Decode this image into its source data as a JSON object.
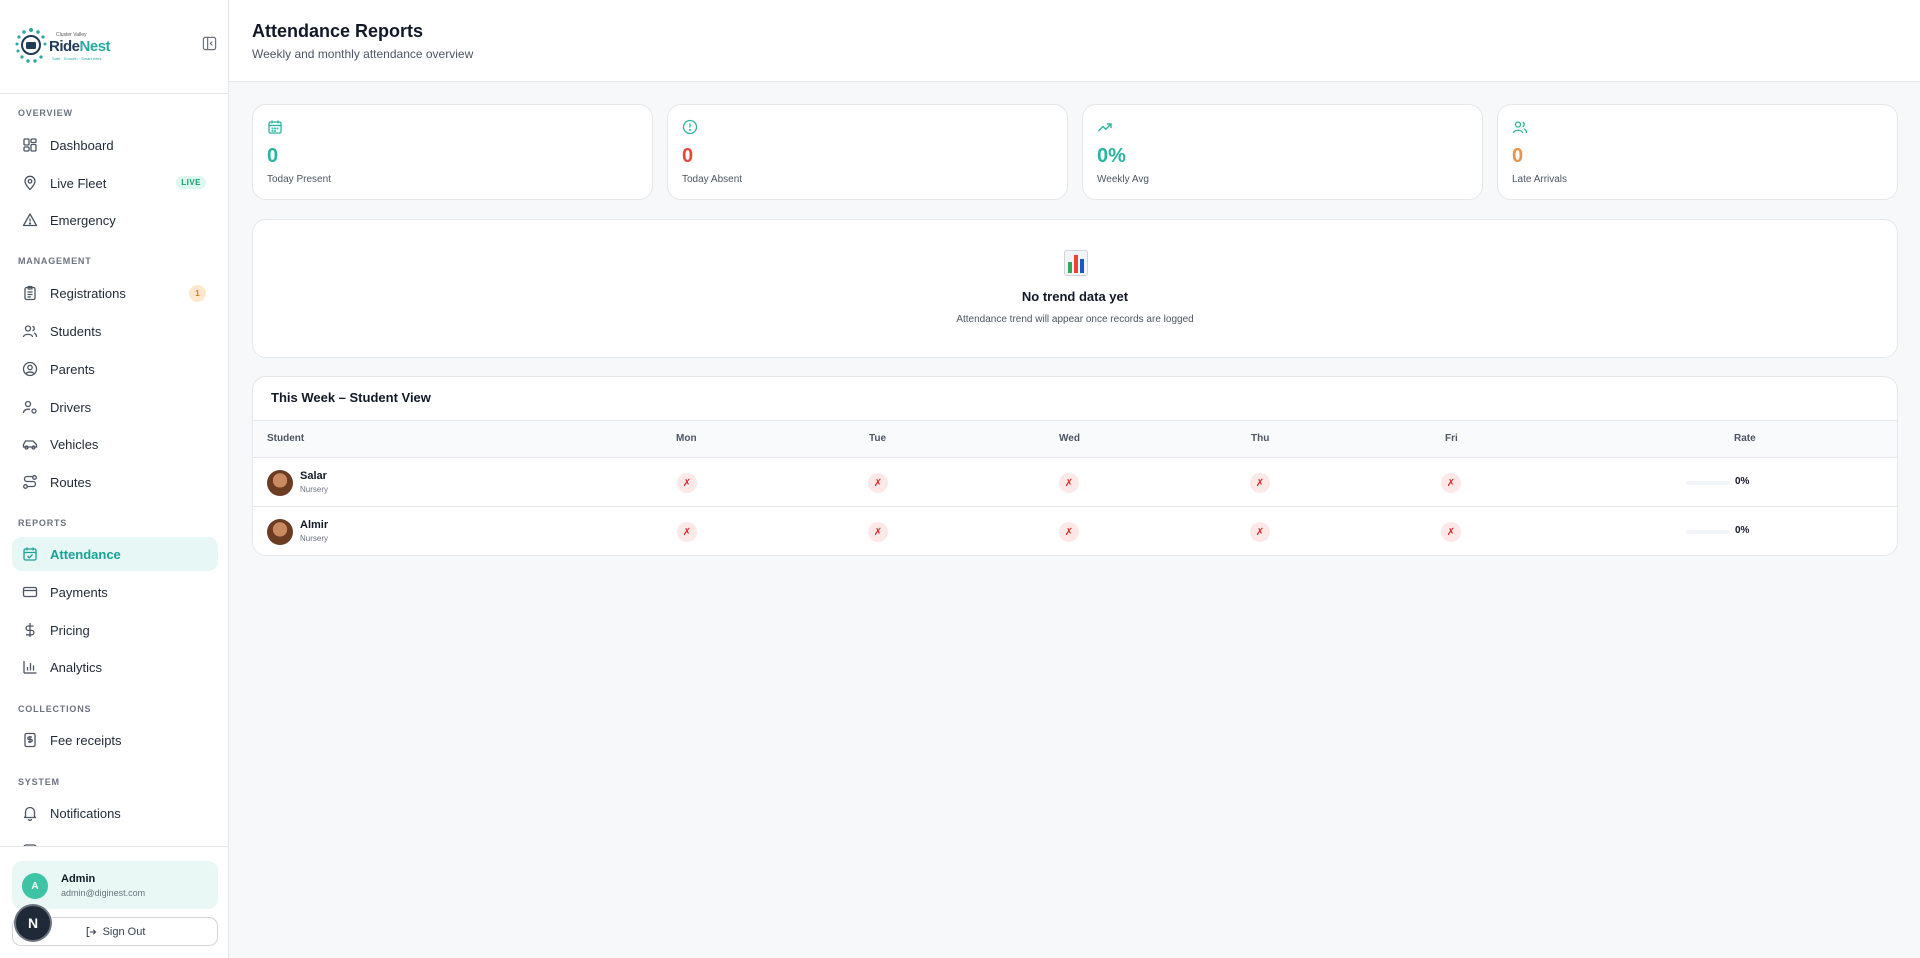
{
  "brand": {
    "line1": "Cluster Valley",
    "name_part1": "Ride",
    "name_part2": "Nest",
    "tagline": "Safe · Smooth · Smart rides"
  },
  "sidebar": {
    "sections": {
      "overview": "OVERVIEW",
      "management": "MANAGEMENT",
      "reports": "REPORTS",
      "collections": "COLLECTIONS",
      "system": "SYSTEM"
    },
    "items": {
      "dashboard": "Dashboard",
      "live_fleet": "Live Fleet",
      "live_badge": "LIVE",
      "emergency": "Emergency",
      "registrations": "Registrations",
      "registrations_count": "1",
      "students": "Students",
      "parents": "Parents",
      "drivers": "Drivers",
      "vehicles": "Vehicles",
      "routes": "Routes",
      "attendance": "Attendance",
      "payments": "Payments",
      "pricing": "Pricing",
      "analytics": "Analytics",
      "fee_receipts": "Fee receipts",
      "notifications": "Notifications"
    },
    "user": {
      "initial": "A",
      "name": "Admin",
      "email": "admin@diginest.com"
    },
    "sign_out": "Sign Out",
    "dev_badge": "N"
  },
  "header": {
    "title": "Attendance Reports",
    "subtitle": "Weekly and monthly attendance overview"
  },
  "stats": [
    {
      "value": "0",
      "label": "Today Present",
      "color": "#2bb5a0",
      "icon": "calendar-icon"
    },
    {
      "value": "0",
      "label": "Today Absent",
      "color": "#e5483b",
      "icon": "alert-circle-icon"
    },
    {
      "value": "0%",
      "label": "Weekly Avg",
      "color": "#2bb5a0",
      "icon": "trending-up-icon"
    },
    {
      "value": "0",
      "label": "Late Arrivals",
      "color": "#e8944a",
      "icon": "users-icon"
    }
  ],
  "trend": {
    "title": "No trend data yet",
    "subtitle": "Attendance trend will appear once records are logged"
  },
  "week": {
    "title": "This Week – Student View",
    "columns": [
      "Student",
      "Mon",
      "Tue",
      "Wed",
      "Thu",
      "Fri",
      "Rate"
    ],
    "rows": [
      {
        "name": "Salar",
        "class": "Nursery",
        "days": [
          "✗",
          "✗",
          "✗",
          "✗",
          "✗"
        ],
        "rate": "0%",
        "rate_fraction": 0
      },
      {
        "name": "Almir",
        "class": "Nursery",
        "days": [
          "✗",
          "✗",
          "✗",
          "✗",
          "✗"
        ],
        "rate": "0%",
        "rate_fraction": 0
      }
    ]
  }
}
